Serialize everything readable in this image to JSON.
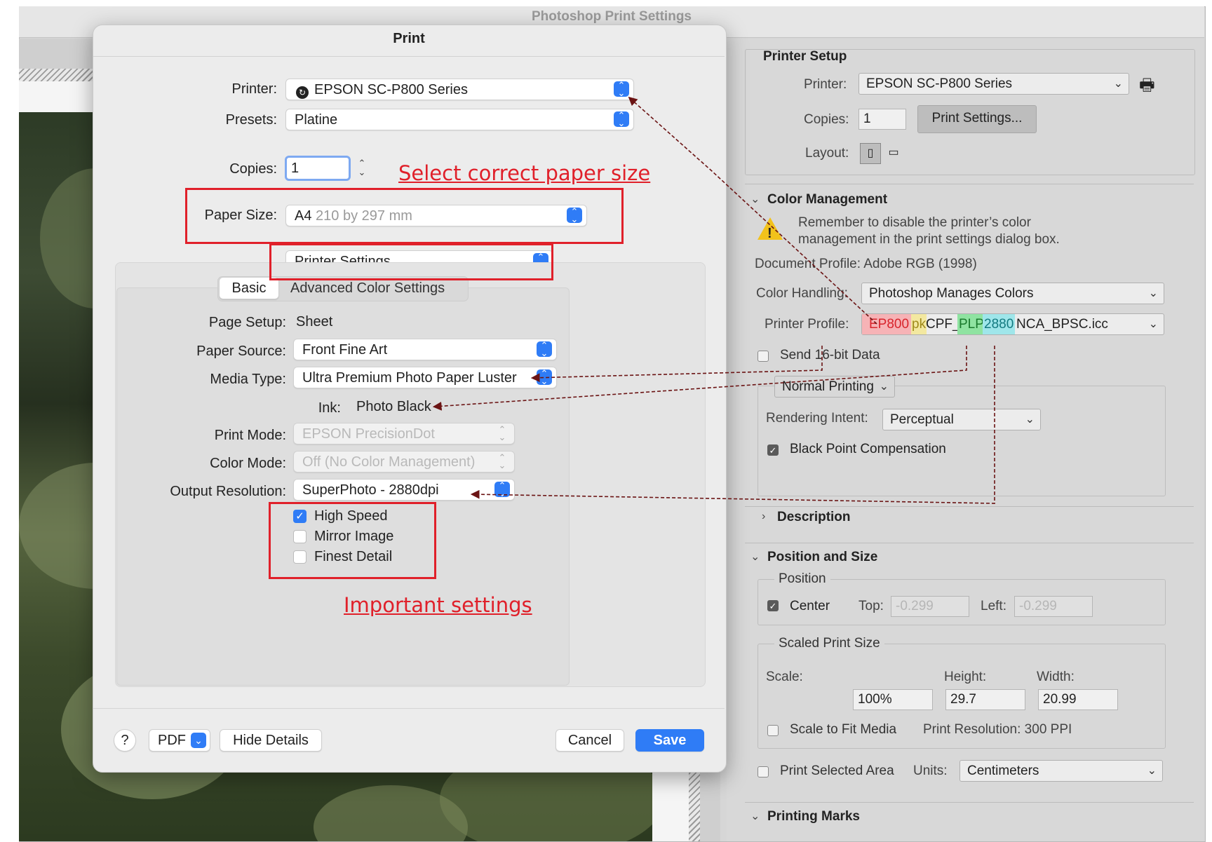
{
  "window_title": "Photoshop Print Settings",
  "print_dialog": {
    "title": "Print",
    "printer_label": "Printer:",
    "printer_value": "EPSON SC-P800 Series",
    "presets_label": "Presets:",
    "presets_value": "Platine",
    "copies_label": "Copies:",
    "copies_value": "1",
    "paper_size_label": "Paper Size:",
    "paper_size_value": "A4",
    "paper_size_dims": "210 by 297 mm",
    "section_value": "Printer Settings",
    "tabs": [
      "Basic",
      "Advanced Color Settings"
    ],
    "page_setup_label": "Page Setup:",
    "page_setup_value": "Sheet",
    "paper_source_label": "Paper Source:",
    "paper_source_value": "Front Fine Art",
    "media_type_label": "Media Type:",
    "media_type_value": "Ultra Premium Photo Paper Luster",
    "ink_label": "Ink:",
    "ink_value": "Photo Black",
    "print_mode_label": "Print Mode:",
    "print_mode_value": "EPSON PrecisionDot",
    "color_mode_label": "Color Mode:",
    "color_mode_value": "Off (No Color Management)",
    "output_resolution_label": "Output Resolution:",
    "output_resolution_value": "SuperPhoto - 2880dpi",
    "options": [
      {
        "label": "High Speed",
        "checked": true
      },
      {
        "label": "Mirror Image",
        "checked": false
      },
      {
        "label": "Finest Detail",
        "checked": false
      }
    ],
    "footer": {
      "help": "?",
      "pdf": "PDF",
      "hide_details": "Hide Details",
      "cancel": "Cancel",
      "save": "Save"
    }
  },
  "annotations": {
    "paper_size_note": "Select correct paper size",
    "settings_note": "Important settings",
    "color": "#e0202a"
  },
  "photoshop_panel": {
    "printer_setup": {
      "title": "Printer Setup",
      "printer_label": "Printer:",
      "printer_value": "EPSON SC-P800 Series",
      "copies_label": "Copies:",
      "copies_value": "1",
      "print_settings_button": "Print Settings...",
      "layout_label": "Layout:"
    },
    "color_management": {
      "title": "Color Management",
      "warning": "Remember to disable the printer’s color management in the print settings dialog box.",
      "document_profile": "Document Profile: Adobe RGB (1998)",
      "color_handling_label": "Color Handling:",
      "color_handling_value": "Photoshop Manages Colors",
      "printer_profile_label": "Printer Profile:",
      "printer_profile_parts": [
        "EP800",
        "pk",
        "CPF_",
        "PLP",
        "2880",
        "NCA_BPSC.icc"
      ],
      "send_16bit": "Send 16-bit Data",
      "normal_printing": "Normal Printing",
      "rendering_intent_label": "Rendering Intent:",
      "rendering_intent_value": "Perceptual",
      "black_point": "Black Point Compensation"
    },
    "description": {
      "title": "Description"
    },
    "position_and_size": {
      "title": "Position and Size",
      "position_title": "Position",
      "center": "Center",
      "top_label": "Top:",
      "top_value": "-0.299",
      "left_label": "Left:",
      "left_value": "-0.299",
      "scaled_title": "Scaled Print Size",
      "scale_label": "Scale:",
      "scale_value": "100%",
      "height_label": "Height:",
      "height_value": "29.7",
      "width_label": "Width:",
      "width_value": "20.99",
      "scale_to_fit": "Scale to Fit Media",
      "print_resolution": "Print Resolution: 300 PPI",
      "print_selected_area": "Print Selected Area",
      "units_label": "Units:",
      "units_value": "Centimeters"
    },
    "printing_marks": {
      "title": "Printing Marks"
    }
  },
  "colors": {
    "accent_blue": "#2f7cf6",
    "profile_red": "#f6b3b6",
    "profile_yellow": "#f3e8a0",
    "profile_green": "#8fe3a1",
    "profile_cyan": "#9fe6ea"
  }
}
